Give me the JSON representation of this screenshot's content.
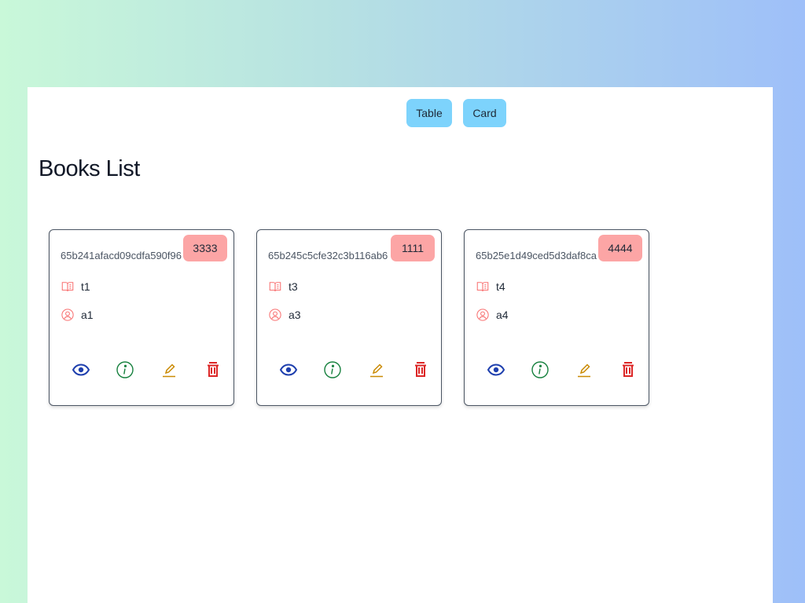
{
  "view_toggle": {
    "table_label": "Table",
    "card_label": "Card"
  },
  "page": {
    "title": "Books List"
  },
  "colors": {
    "toggle_button": "#7dd3fc",
    "price_badge": "#fca5a5",
    "view_icon": "#1e3fae",
    "info_icon": "#15803d",
    "edit_icon": "#ca8a04",
    "delete_icon": "#dc2626",
    "meta_icon": "#f87171"
  },
  "books": [
    {
      "id": "65b241afacd09cdfa590f96",
      "price": "3333",
      "title": "t1",
      "author": "a1"
    },
    {
      "id": "65b245c5cfe32c3b116ab6",
      "price": "1111",
      "title": "t3",
      "author": "a3"
    },
    {
      "id": "65b25e1d49ced5d3daf8ca",
      "price": "4444",
      "title": "t4",
      "author": "a4"
    }
  ],
  "icons": {
    "title": "book-open-icon",
    "author": "user-circle-icon",
    "view": "eye-icon",
    "info": "info-circle-icon",
    "edit": "pencil-icon",
    "delete": "trash-icon"
  }
}
